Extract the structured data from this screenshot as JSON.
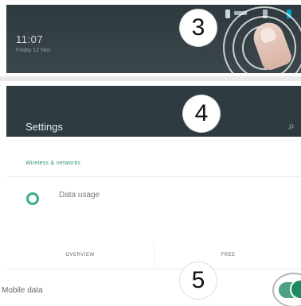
{
  "panel1": {
    "time": "11:07",
    "date": "Friday 12 Nov",
    "step_badge": "3"
  },
  "panel2": {
    "step_badge": "4",
    "title": "Settings",
    "section_label": "Wireless & networks",
    "row_label": "Data usage",
    "icons": {
      "search": "search-icon",
      "data_usage": "data-usage-icon"
    }
  },
  "panel3": {
    "tabs": [
      "OVERVIEW",
      "FREE"
    ],
    "step_badge": "5",
    "setting_label": "Mobile data",
    "toggle_state": "on"
  },
  "colors": {
    "appbar": "#2e3b40",
    "accent": "#2f8f6a",
    "shade": "#2f3a3f"
  }
}
